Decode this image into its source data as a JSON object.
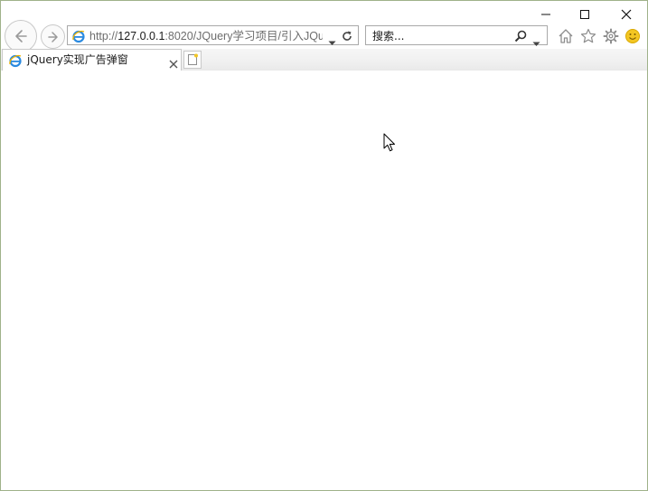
{
  "window": {
    "controls": {
      "minimize": "minimize-icon",
      "maximize": "maximize-icon",
      "close": "close-icon"
    },
    "frame_color": "#9fb28a"
  },
  "nav": {
    "back": "back-arrow-icon",
    "forward": "forward-arrow-icon"
  },
  "address_bar": {
    "scheme": "http://",
    "host": "127.0.0.1",
    "rest": ":8020/JQuery学习项目/引入JQu",
    "favicon": "ie-logo-icon",
    "dropdown": "chevron-down-icon",
    "refresh": "refresh-icon"
  },
  "search": {
    "placeholder": "搜索...",
    "icon": "search-icon",
    "dropdown": "chevron-down-icon"
  },
  "toolbar": {
    "home": "home-icon",
    "favorites": "star-icon",
    "tools": "gear-icon",
    "feedback": "smiley-icon"
  },
  "tabs": [
    {
      "title": "jQuery实现广告弹窗",
      "favicon": "ie-logo-icon",
      "active": true
    }
  ],
  "new_tab": "new-tab-icon",
  "colors": {
    "accent_ie": "#2a8ae0",
    "smiley": "#f3c623"
  }
}
